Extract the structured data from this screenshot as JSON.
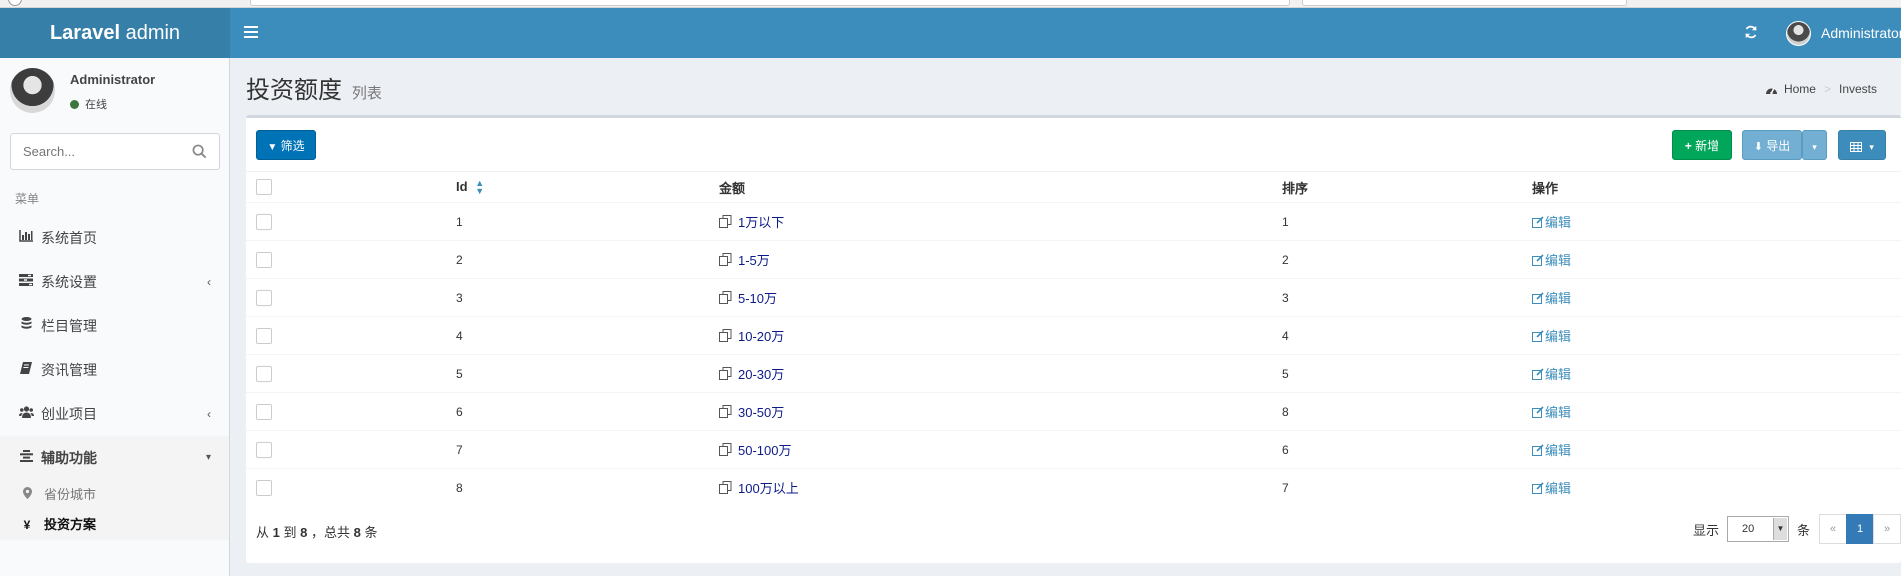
{
  "header": {
    "logo_bold": "Laravel",
    "logo_rest": " admin",
    "user_name": "Administrator"
  },
  "sidebar": {
    "user_name": "Administrator",
    "status": "在线",
    "search_placeholder": "Search...",
    "menu_header": "菜单",
    "items": [
      {
        "label": "系统首页",
        "icon": "bar-chart-icon"
      },
      {
        "label": "系统设置",
        "icon": "tasks-icon",
        "has_children": true
      },
      {
        "label": "栏目管理",
        "icon": "database-icon"
      },
      {
        "label": "资讯管理",
        "icon": "book-icon"
      },
      {
        "label": "创业项目",
        "icon": "users-icon",
        "has_children": true
      },
      {
        "label": "辅助功能",
        "icon": "align-center-icon",
        "open": true
      }
    ],
    "subitems": [
      {
        "label": "省份城市",
        "icon": "map-marker-icon"
      },
      {
        "label": "投资方案",
        "icon": "yen-icon",
        "active": true
      }
    ]
  },
  "content": {
    "title": "投资额度",
    "subtitle": "列表",
    "breadcrumb": {
      "home": "Home",
      "current": "Invests"
    }
  },
  "toolbar": {
    "filter": "筛选",
    "new": "新增",
    "export": "导出"
  },
  "table": {
    "headers": {
      "id": "Id",
      "amount": "金额",
      "sort": "排序",
      "action": "操作"
    },
    "rows": [
      {
        "id": "1",
        "amount": "1万以下",
        "sort": "1",
        "action": "编辑"
      },
      {
        "id": "2",
        "amount": "1-5万",
        "sort": "2",
        "action": "编辑"
      },
      {
        "id": "3",
        "amount": "5-10万",
        "sort": "3",
        "action": "编辑"
      },
      {
        "id": "4",
        "amount": "10-20万",
        "sort": "4",
        "action": "编辑"
      },
      {
        "id": "5",
        "amount": "20-30万",
        "sort": "5",
        "action": "编辑"
      },
      {
        "id": "6",
        "amount": "30-50万",
        "sort": "8",
        "action": "编辑"
      },
      {
        "id": "7",
        "amount": "50-100万",
        "sort": "6",
        "action": "编辑"
      },
      {
        "id": "8",
        "amount": "100万以上",
        "sort": "7",
        "action": "编辑"
      }
    ]
  },
  "footer": {
    "from_label": "从",
    "from": "1",
    "to_label": "到",
    "to": "8",
    "total_label": "，总共",
    "total": "8",
    "unit": "条",
    "show_label": "显示",
    "per_page": "20",
    "per_page_unit": "条",
    "prev": "«",
    "current_page": "1",
    "next": "»"
  }
}
